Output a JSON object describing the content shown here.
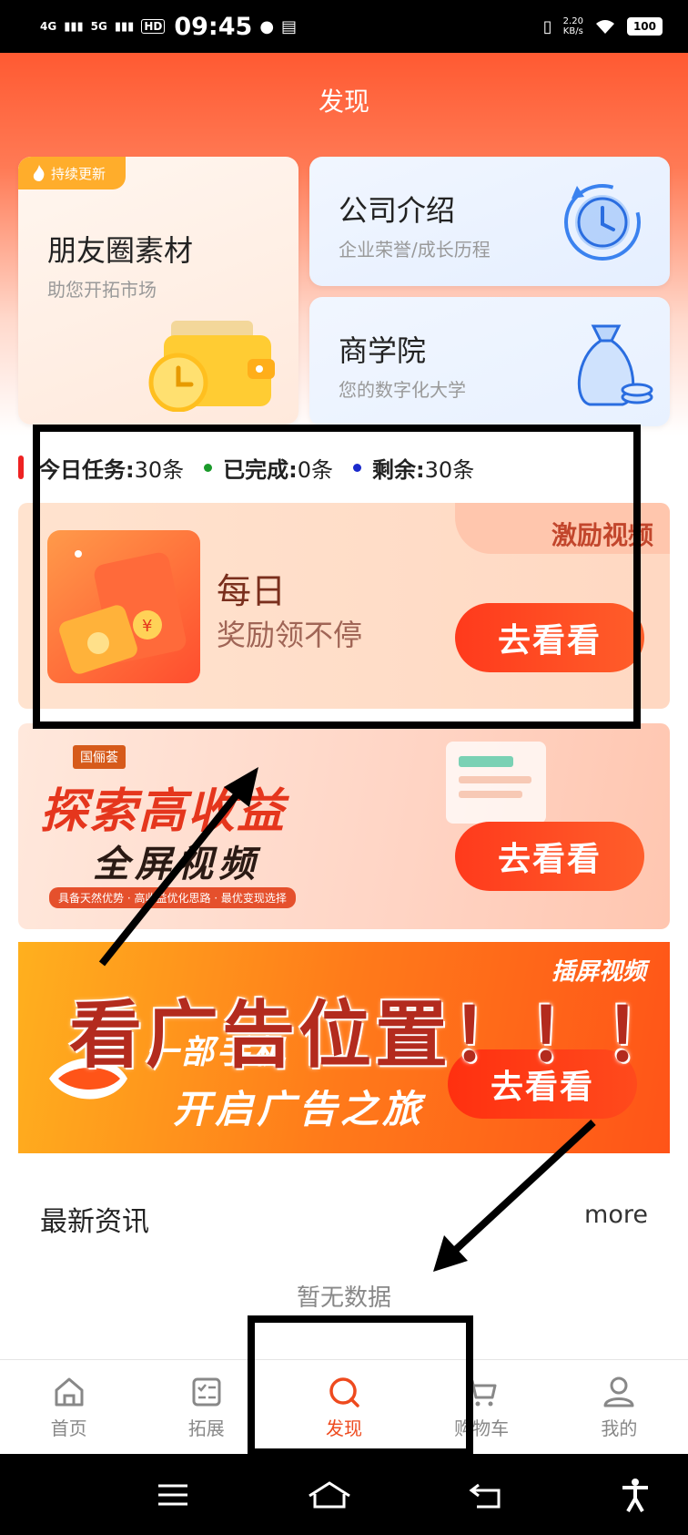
{
  "status_bar": {
    "signal1": "4G",
    "signal2": "5G",
    "hd": "HD",
    "time": "09:45",
    "speed_value": "2.20",
    "speed_unit": "KB/s",
    "battery": "100"
  },
  "header": {
    "title": "发现"
  },
  "cards": {
    "moments": {
      "tag": "持续更新",
      "title": "朋友圈素材",
      "subtitle": "助您开拓市场"
    },
    "company": {
      "title": "公司介绍",
      "subtitle": "企业荣誉/成长历程"
    },
    "academy": {
      "title": "商学院",
      "subtitle": "您的数字化大学"
    }
  },
  "tasks": {
    "today_label": "今日任务:",
    "today_value": "30条",
    "done_label": "已完成:",
    "done_value": "0条",
    "remain_label": "剩余:",
    "remain_value": "30条",
    "colors": {
      "bar": "#ee2222",
      "done_dot": "#1a9a2a",
      "remain_dot": "#1a2acc"
    }
  },
  "banners": {
    "reward": {
      "tab": "激励视频",
      "line1": "每日",
      "line2": "奖励领不停",
      "button": "去看看"
    },
    "fullscreen": {
      "brand": "国俪荟",
      "headline": "探索高收益",
      "subheadline": "全屏视频",
      "strip": "具备天然优势 · 高收益优化思路 · 最优变现选择",
      "button": "去看看"
    },
    "interstitial": {
      "tab": "插屏视频",
      "line1": "一部手机",
      "line2": "开启广告之旅",
      "button": "去看看"
    }
  },
  "annotation": {
    "text": "看广告位置！！！"
  },
  "news": {
    "title": "最新资讯",
    "more": "more",
    "empty": "暂无数据"
  },
  "tabbar": {
    "items": [
      {
        "label": "首页",
        "icon": "home-icon"
      },
      {
        "label": "拓展",
        "icon": "checklist-icon"
      },
      {
        "label": "发现",
        "icon": "search-icon",
        "active": true
      },
      {
        "label": "购物车",
        "icon": "cart-icon"
      },
      {
        "label": "我的",
        "icon": "user-icon"
      }
    ],
    "active_color": "#ee4a1e"
  },
  "theme": {
    "accent": "#ff5a32"
  }
}
